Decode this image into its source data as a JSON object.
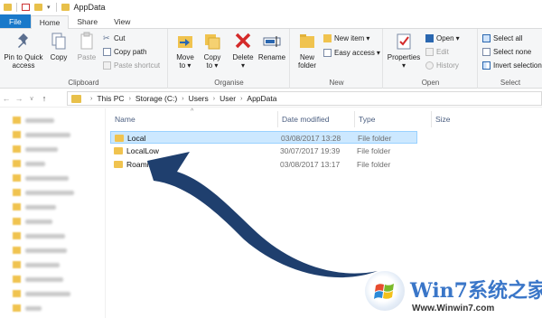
{
  "window": {
    "title": "AppData"
  },
  "tabs": {
    "file": "File",
    "home": "Home",
    "share": "Share",
    "view": "View"
  },
  "ribbon": {
    "clipboard": {
      "label": "Clipboard",
      "pin_line1": "Pin to Quick",
      "pin_line2": "access",
      "copy": "Copy",
      "paste": "Paste",
      "cut": "Cut",
      "copy_path": "Copy path",
      "paste_shortcut": "Paste shortcut"
    },
    "organise": {
      "label": "Organise",
      "move_to_line1": "Move",
      "move_to_line2": "to",
      "copy_to_line1": "Copy",
      "copy_to_line2": "to",
      "delete": "Delete",
      "rename": "Rename"
    },
    "new": {
      "label": "New",
      "new_folder_line1": "New",
      "new_folder_line2": "folder",
      "new_item": "New item",
      "easy_access": "Easy access"
    },
    "open": {
      "label": "Open",
      "properties": "Properties",
      "open": "Open",
      "edit": "Edit",
      "history": "History"
    },
    "select": {
      "label": "Select",
      "select_all": "Select all",
      "select_none": "Select none",
      "invert_selection": "Invert selection"
    }
  },
  "address": {
    "crumbs": [
      "This PC",
      "Storage (C:)",
      "Users",
      "User",
      "AppData"
    ]
  },
  "columns": {
    "name": "Name",
    "date_modified": "Date modified",
    "type": "Type",
    "size": "Size"
  },
  "files": [
    {
      "name": "Local",
      "date": "03/08/2017 13:28",
      "type": "File folder",
      "selected": true
    },
    {
      "name": "LocalLow",
      "date": "30/07/2017 19:39",
      "type": "File folder",
      "selected": false
    },
    {
      "name": "Roaming",
      "date": "03/08/2017 13:17",
      "type": "File folder",
      "selected": false
    }
  ],
  "watermark": {
    "brand": "Win7系统之家",
    "url": "Www.Winwin7.com"
  },
  "colors": {
    "file_tab": "#1979ca",
    "selection": "#cce8ff",
    "folder": "#f0c34f",
    "arrow": "#1f3f6e"
  }
}
